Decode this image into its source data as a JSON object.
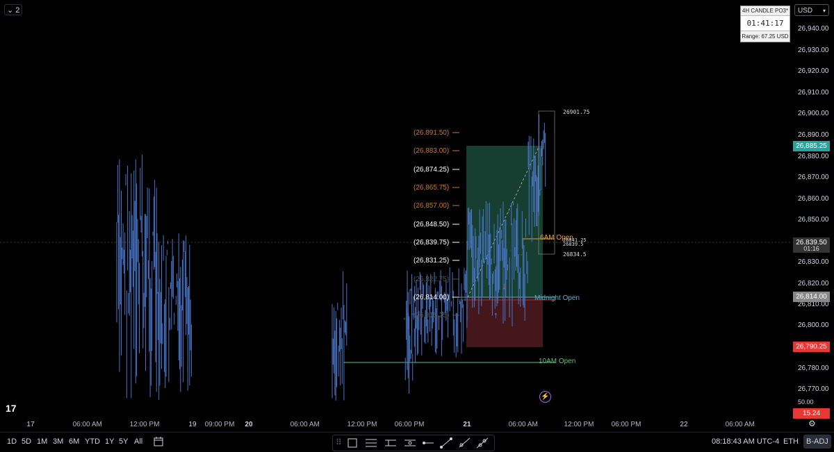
{
  "top_left_button": {
    "label": "2"
  },
  "info_box": {
    "title": "4H CANDLE PO3*",
    "timer": "01:41:17",
    "range": "Range: 67.25 USD"
  },
  "currency": {
    "label": "USD"
  },
  "price_axis": [
    "26,940.00",
    "26,930.00",
    "26,920.00",
    "26,910.00",
    "26,900.00",
    "26,890.00",
    "26,880.00",
    "26,870.00",
    "26,860.00",
    "26,850.00",
    "26,830.00",
    "26,820.00",
    "26,810.00",
    "26,800.00",
    "26,780.00",
    "26,770.00"
  ],
  "price_tags": {
    "high_tag": "26,885.25",
    "last_price": "26,839.50",
    "countdown": "01:16",
    "midnight_tag": "26,814.00",
    "low_tag": "26,790.25",
    "indicator_top": "50.00",
    "indicator_value": "15.24"
  },
  "fib_levels": [
    {
      "label": "(26,891.50)",
      "color": "#c77a2a"
    },
    {
      "label": "(26,883.00)",
      "color": "#c77a2a"
    },
    {
      "label": "(26,874.25)",
      "color": "#ffffff"
    },
    {
      "label": "(26,865.75)",
      "color": "#c77a2a"
    },
    {
      "label": "(26,857.00)",
      "color": "#c77a2a"
    },
    {
      "label": "(26,848.50)",
      "color": "#ffffff"
    },
    {
      "label": "(26,839.75)",
      "color": "#ffffff"
    },
    {
      "label": "(26,831.25)",
      "color": "#ffffff"
    },
    {
      "label": "(26,822.75)",
      "color": "#555555"
    },
    {
      "label": "(26,814.00)",
      "color": "#ffffff"
    },
    {
      "label": "(26,805.25)",
      "color": "#555555"
    }
  ],
  "annotations": {
    "high_label": "26901.75",
    "six_am_open": "6AM Open",
    "six_am_value": "26841.25",
    "mid_value": "26839.5",
    "low_label": "26834.5",
    "midnight_open": "Midnight Open",
    "ten_am_open": "10AM Open"
  },
  "time_axis": [
    "17",
    "06:00 AM",
    "12:00 PM",
    "19",
    "09:00 PM",
    "20",
    "06:00 AM",
    "12:00 PM",
    "06:00 PM",
    "21",
    "06:00 AM",
    "12:00 PM",
    "06:00 PM",
    "22",
    "06:00 AM"
  ],
  "bottom": {
    "ranges": [
      "1D",
      "5D",
      "1M",
      "3M",
      "6M",
      "YTD",
      "1Y",
      "5Y",
      "All"
    ],
    "clock": "08:18:43 AM UTC-4",
    "session": "ETH",
    "adj": "B-ADJ"
  },
  "colors": {
    "candle": "#4a76c8",
    "green_zone": "#1b4a3a",
    "red_zone": "#4a1a1e",
    "orange": "#e8a040",
    "teal": "#4fb0c6",
    "green_line": "#5fc07a"
  }
}
